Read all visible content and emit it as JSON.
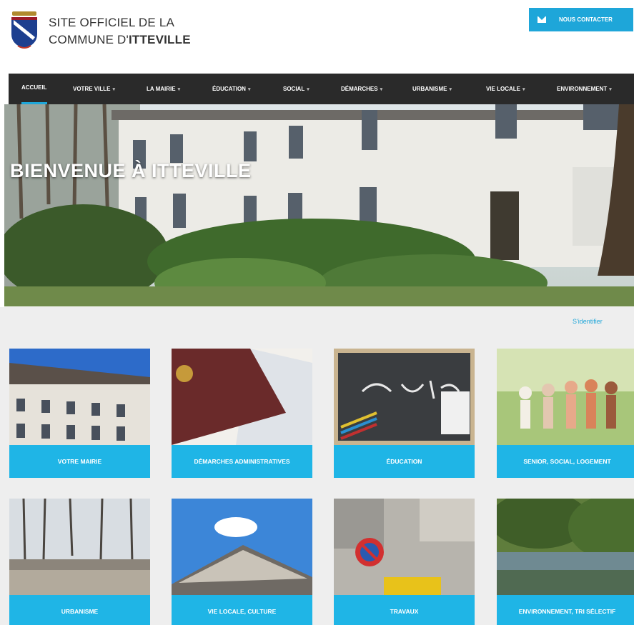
{
  "header": {
    "title_line1": "SITE OFFICIEL DE LA",
    "title_line2_prefix": "COMMUNE D'",
    "title_line2_bold": "ITTEVILLE",
    "contact_label": "NOUS CONTACTER"
  },
  "nav": {
    "items": [
      {
        "label": "ACCUEIL",
        "caret": false
      },
      {
        "label": "VOTRE VILLE",
        "caret": true
      },
      {
        "label": "LA MAIRIE",
        "caret": true
      },
      {
        "label": "ÉDUCATION",
        "caret": true
      },
      {
        "label": "SOCIAL",
        "caret": true
      },
      {
        "label": "DÉMARCHES",
        "caret": true
      },
      {
        "label": "URBANISME",
        "caret": true
      },
      {
        "label": "VIE LOCALE",
        "caret": true
      },
      {
        "label": "ENVIRONNEMENT",
        "caret": true
      }
    ]
  },
  "hero": {
    "title": "BIENVENUE À ITTEVILLE"
  },
  "login_link": "S'identifier",
  "tiles": [
    {
      "label": "VOTRE MAIRIE"
    },
    {
      "label": "DÉMARCHES ADMINISTRATIVES"
    },
    {
      "label": "ÉDUCATION"
    },
    {
      "label": "SENIOR, SOCIAL, LOGEMENT"
    },
    {
      "label": "URBANISME"
    },
    {
      "label": "VIE LOCALE, CULTURE"
    },
    {
      "label": "TRAVAUX"
    },
    {
      "label": "ENVIRONNEMENT, TRI SÉLECTIF"
    }
  ],
  "colors": {
    "accent": "#1fb5e6",
    "nav_bg": "#2a2a2a",
    "content_bg": "#eeeeee"
  }
}
